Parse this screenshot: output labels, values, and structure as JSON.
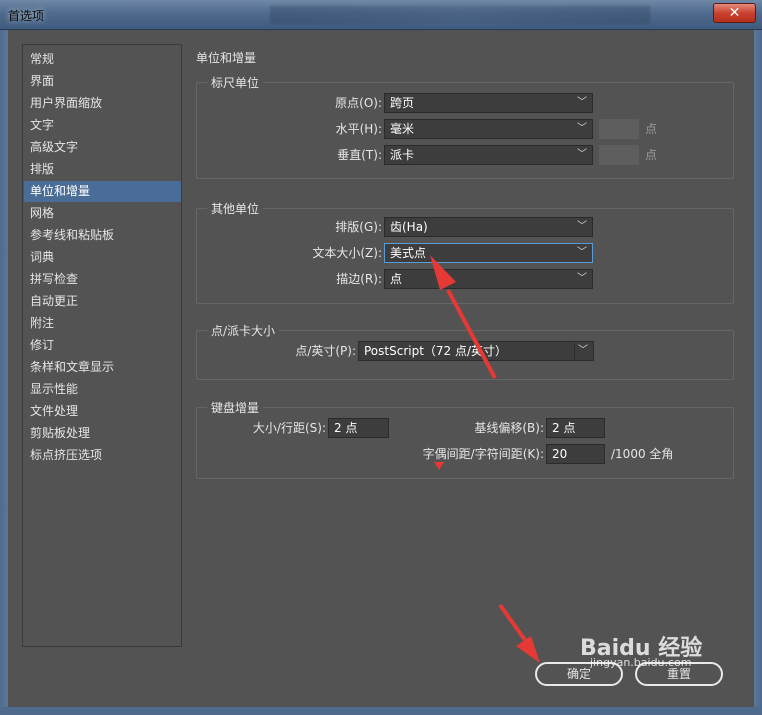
{
  "window": {
    "title": "首选项",
    "close_glyph": "✕"
  },
  "sidebar": {
    "items": [
      {
        "label": "常规"
      },
      {
        "label": "界面"
      },
      {
        "label": "用户界面缩放"
      },
      {
        "label": "文字"
      },
      {
        "label": "高级文字"
      },
      {
        "label": "排版"
      },
      {
        "label": "单位和增量",
        "selected": true
      },
      {
        "label": "网格"
      },
      {
        "label": "参考线和粘贴板"
      },
      {
        "label": "词典"
      },
      {
        "label": "拼写检查"
      },
      {
        "label": "自动更正"
      },
      {
        "label": "附注"
      },
      {
        "label": "修订"
      },
      {
        "label": "条样和文章显示"
      },
      {
        "label": "显示性能"
      },
      {
        "label": "文件处理"
      },
      {
        "label": "剪贴板处理"
      },
      {
        "label": "标点挤压选项"
      }
    ]
  },
  "main": {
    "section_title": "单位和增量",
    "ruler_units": {
      "legend": "标尺单位",
      "origin_label": "原点(O):",
      "origin_value": "跨页",
      "horizontal_label": "水平(H):",
      "horizontal_value": "毫米",
      "horizontal_unit": "点",
      "vertical_label": "垂直(T):",
      "vertical_value": "派卡",
      "vertical_unit": "点"
    },
    "other_units": {
      "legend": "其他单位",
      "composition_label": "排版(G):",
      "composition_value": "齿(Ha)",
      "text_size_label": "文本大小(Z):",
      "text_size_value": "美式点",
      "stroke_label": "描边(R):",
      "stroke_value": "点"
    },
    "point_pica": {
      "legend": "点/派卡大小",
      "points_inch_label": "点/英寸(P):",
      "points_inch_value": "PostScript（72 点/英寸）"
    },
    "keyboard": {
      "legend": "键盘增量",
      "size_leading_label": "大小/行距(S):",
      "size_leading_value": "2 点",
      "baseline_shift_label": "基线偏移(B):",
      "baseline_shift_value": "2 点",
      "kerning_label": "字偶间距/字符间距(K):",
      "kerning_value": "20",
      "kerning_unit": "/1000 全角"
    }
  },
  "buttons": {
    "ok": "确定",
    "reset": "重置"
  },
  "watermark": {
    "brand": "Baidu 经验",
    "url": "jingyan.baidu.com"
  },
  "colors": {
    "panel": "#535353",
    "selection": "#4a6d98",
    "annotation_arrow": "#e53935"
  }
}
